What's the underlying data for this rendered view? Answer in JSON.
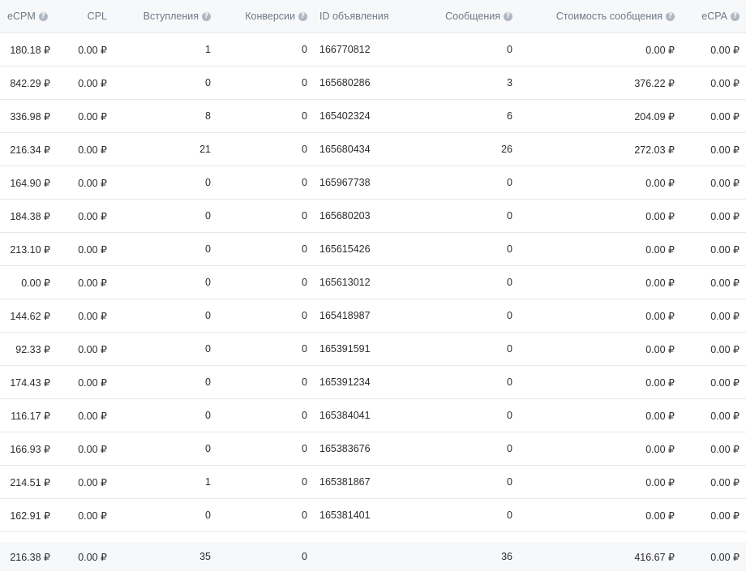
{
  "columns": [
    {
      "key": "ecpm",
      "label": "eCPM",
      "help": true
    },
    {
      "key": "cpl",
      "label": "CPL",
      "help": false
    },
    {
      "key": "joins",
      "label": "Вступления",
      "help": true
    },
    {
      "key": "conv",
      "label": "Конверсии",
      "help": true
    },
    {
      "key": "adid",
      "label": "ID объявления",
      "help": false
    },
    {
      "key": "msgs",
      "label": "Сообщения",
      "help": true
    },
    {
      "key": "msgcost",
      "label": "Стоимость сообщения",
      "help": true
    },
    {
      "key": "ecpa",
      "label": "eCPA",
      "help": true
    }
  ],
  "help_glyph": "?",
  "rows": [
    {
      "ecpm": "180.18 ₽",
      "cpl": "0.00 ₽",
      "joins": "1",
      "conv": "0",
      "adid": "166770812",
      "msgs": "0",
      "msgcost": "0.00 ₽",
      "ecpa": "0.00 ₽"
    },
    {
      "ecpm": "842.29 ₽",
      "cpl": "0.00 ₽",
      "joins": "0",
      "conv": "0",
      "adid": "165680286",
      "msgs": "3",
      "msgcost": "376.22 ₽",
      "ecpa": "0.00 ₽"
    },
    {
      "ecpm": "336.98 ₽",
      "cpl": "0.00 ₽",
      "joins": "8",
      "conv": "0",
      "adid": "165402324",
      "msgs": "6",
      "msgcost": "204.09 ₽",
      "ecpa": "0.00 ₽"
    },
    {
      "ecpm": "216.34 ₽",
      "cpl": "0.00 ₽",
      "joins": "21",
      "conv": "0",
      "adid": "165680434",
      "msgs": "26",
      "msgcost": "272.03 ₽",
      "ecpa": "0.00 ₽"
    },
    {
      "ecpm": "164.90 ₽",
      "cpl": "0.00 ₽",
      "joins": "0",
      "conv": "0",
      "adid": "165967738",
      "msgs": "0",
      "msgcost": "0.00 ₽",
      "ecpa": "0.00 ₽"
    },
    {
      "ecpm": "184.38 ₽",
      "cpl": "0.00 ₽",
      "joins": "0",
      "conv": "0",
      "adid": "165680203",
      "msgs": "0",
      "msgcost": "0.00 ₽",
      "ecpa": "0.00 ₽"
    },
    {
      "ecpm": "213.10 ₽",
      "cpl": "0.00 ₽",
      "joins": "0",
      "conv": "0",
      "adid": "165615426",
      "msgs": "0",
      "msgcost": "0.00 ₽",
      "ecpa": "0.00 ₽"
    },
    {
      "ecpm": "0.00 ₽",
      "cpl": "0.00 ₽",
      "joins": "0",
      "conv": "0",
      "adid": "165613012",
      "msgs": "0",
      "msgcost": "0.00 ₽",
      "ecpa": "0.00 ₽"
    },
    {
      "ecpm": "144.62 ₽",
      "cpl": "0.00 ₽",
      "joins": "0",
      "conv": "0",
      "adid": "165418987",
      "msgs": "0",
      "msgcost": "0.00 ₽",
      "ecpa": "0.00 ₽"
    },
    {
      "ecpm": "92.33 ₽",
      "cpl": "0.00 ₽",
      "joins": "0",
      "conv": "0",
      "adid": "165391591",
      "msgs": "0",
      "msgcost": "0.00 ₽",
      "ecpa": "0.00 ₽"
    },
    {
      "ecpm": "174.43 ₽",
      "cpl": "0.00 ₽",
      "joins": "0",
      "conv": "0",
      "adid": "165391234",
      "msgs": "0",
      "msgcost": "0.00 ₽",
      "ecpa": "0.00 ₽"
    },
    {
      "ecpm": "116.17 ₽",
      "cpl": "0.00 ₽",
      "joins": "0",
      "conv": "0",
      "adid": "165384041",
      "msgs": "0",
      "msgcost": "0.00 ₽",
      "ecpa": "0.00 ₽"
    },
    {
      "ecpm": "166.93 ₽",
      "cpl": "0.00 ₽",
      "joins": "0",
      "conv": "0",
      "adid": "165383676",
      "msgs": "0",
      "msgcost": "0.00 ₽",
      "ecpa": "0.00 ₽"
    },
    {
      "ecpm": "214.51 ₽",
      "cpl": "0.00 ₽",
      "joins": "1",
      "conv": "0",
      "adid": "165381867",
      "msgs": "0",
      "msgcost": "0.00 ₽",
      "ecpa": "0.00 ₽"
    },
    {
      "ecpm": "162.91 ₽",
      "cpl": "0.00 ₽",
      "joins": "0",
      "conv": "0",
      "adid": "165381401",
      "msgs": "0",
      "msgcost": "0.00 ₽",
      "ecpa": "0.00 ₽"
    }
  ],
  "totals": {
    "ecpm": "216.38 ₽",
    "cpl": "0.00 ₽",
    "joins": "35",
    "conv": "0",
    "adid": "",
    "msgs": "36",
    "msgcost": "416.67 ₽",
    "ecpa": "0.00 ₽"
  },
  "colors": {
    "header_bg": "#f7f8fa",
    "header_text": "#6f7985",
    "text": "#2c2d2e",
    "divider": "#e7e8ec",
    "help_icon": "#aeb7c2"
  }
}
